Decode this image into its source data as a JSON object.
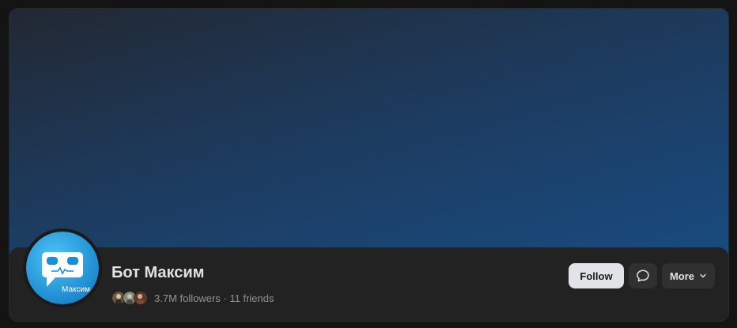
{
  "profile": {
    "name": "Бот Максим",
    "followers": "3.7M followers",
    "separator": " · ",
    "friends": "11 friends",
    "avatar_caption": "Максим"
  },
  "actions": {
    "follow_label": "Follow",
    "more_label": "More"
  },
  "icons": {
    "message": "message-bubble-icon",
    "more": "chevron-down-icon"
  },
  "colors": {
    "cover_top": "#222832",
    "cover_bottom": "#194b80",
    "card_bg": "#222222",
    "follow_bg": "#e1e3e6",
    "secondary_btn_bg": "#303030",
    "avatar_blue": "#2a9fe0"
  }
}
